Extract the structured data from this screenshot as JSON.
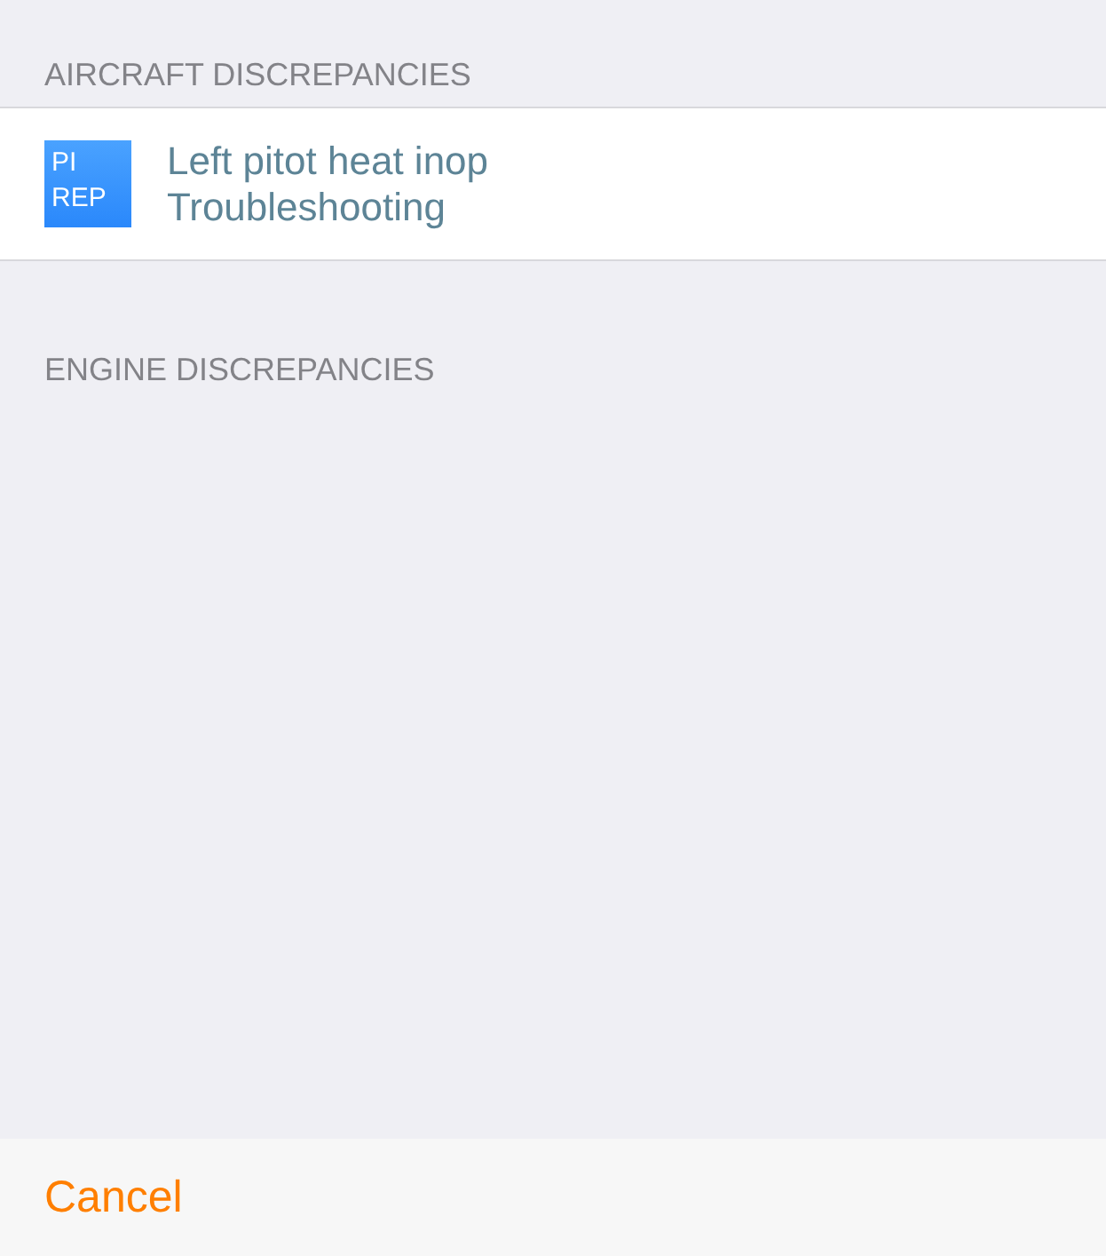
{
  "sections": [
    {
      "title": "AIRCRAFT DISCREPANCIES",
      "items": [
        {
          "badge": "PI\nREP",
          "title": "Left pitot heat inop",
          "subtitle": "Troubleshooting"
        }
      ]
    },
    {
      "title": "ENGINE DISCREPANCIES"
    }
  ],
  "footer": {
    "button": "Cancel"
  }
}
